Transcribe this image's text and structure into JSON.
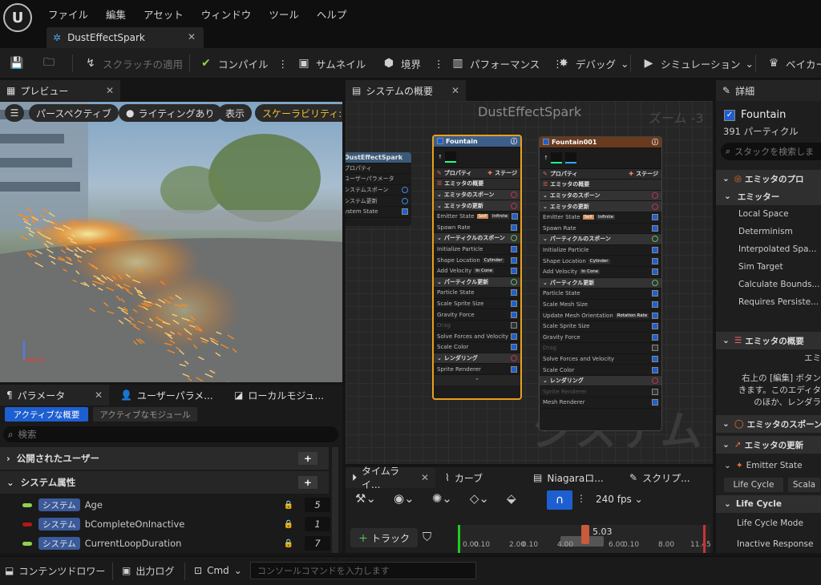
{
  "menu": [
    "ファイル",
    "編集",
    "アセット",
    "ウィンドウ",
    "ツール",
    "ヘルプ"
  ],
  "doc_tab": {
    "title": "DustEffectSpark"
  },
  "toolbar": {
    "apply_scratch": "スクラッチの適用",
    "compile": "コンパイル",
    "thumbnail": "サムネイル",
    "bounds": "境界",
    "performance": "パフォーマンス",
    "debug": "デバッグ",
    "simulation": "シミュレーション",
    "baker": "ベイカー"
  },
  "preview": {
    "tab": "プレビュー",
    "perspective": "パースペクティブ",
    "lighting": "ライティングあり",
    "show": "表示",
    "scalability": "スケーラビリティ:シ"
  },
  "graph": {
    "tab": "システムの概要",
    "title": "DustEffectSpark",
    "zoom": "ズーム -3",
    "watermark": "システム",
    "system_node": {
      "title": "DustEffectSpark",
      "rows": [
        "プロパティ",
        "ユーザーパラメータ",
        "システムスポーン",
        "システム更新",
        "ystem State"
      ]
    },
    "fountain": {
      "title": "Fountain",
      "props": "プロパティ",
      "stage": "ステージ",
      "summary": "エミッタの概要",
      "rows": [
        {
          "t": "エミッタのスポーン",
          "k": "sub"
        },
        {
          "t": "エミッタの更新",
          "k": "sub"
        },
        {
          "t": "Emitter State",
          "k": "row",
          "tag": "Self",
          "tag2": "Infinite"
        },
        {
          "t": "Spawn Rate",
          "k": "row"
        },
        {
          "t": "パーティクルのスポーン",
          "k": "sub"
        },
        {
          "t": "Initialize Particle",
          "k": "row"
        },
        {
          "t": "Shape Location",
          "k": "row",
          "tag": "Cylinder"
        },
        {
          "t": "Add Velocity",
          "k": "row",
          "tag": "In Cone"
        },
        {
          "t": "パーティクル更新",
          "k": "sub"
        },
        {
          "t": "Particle State",
          "k": "row"
        },
        {
          "t": "Scale Sprite Size",
          "k": "row"
        },
        {
          "t": "Gravity Force",
          "k": "row"
        },
        {
          "t": "Drag",
          "k": "off"
        },
        {
          "t": "Solve Forces and Velocity",
          "k": "row"
        },
        {
          "t": "Scale Color",
          "k": "row"
        },
        {
          "t": "レンダリング",
          "k": "sub"
        },
        {
          "t": "Sprite Renderer",
          "k": "row"
        }
      ]
    },
    "fountain001": {
      "title": "Fountain001",
      "props": "プロパティ",
      "stage": "ステージ",
      "summary": "エミッタの概要",
      "rows": [
        {
          "t": "エミッタのスポーン",
          "k": "sub"
        },
        {
          "t": "エミッタの更新",
          "k": "sub"
        },
        {
          "t": "Emitter State",
          "k": "row",
          "tag": "Self",
          "tag2": "Infinite"
        },
        {
          "t": "Spawn Rate",
          "k": "row"
        },
        {
          "t": "パーティクルのスポーン",
          "k": "sub"
        },
        {
          "t": "Initialize Particle",
          "k": "row"
        },
        {
          "t": "Shape Location",
          "k": "row",
          "tag": "Cylinder"
        },
        {
          "t": "Add Velocity",
          "k": "row",
          "tag": "In Cone"
        },
        {
          "t": "パーティクル更新",
          "k": "sub"
        },
        {
          "t": "Particle State",
          "k": "row"
        },
        {
          "t": "Scale Mesh Size",
          "k": "row"
        },
        {
          "t": "Update Mesh Orientation",
          "k": "row",
          "tag": "Rotation Rate"
        },
        {
          "t": "Scale Sprite Size",
          "k": "row"
        },
        {
          "t": "Gravity Force",
          "k": "row"
        },
        {
          "t": "Drag",
          "k": "off"
        },
        {
          "t": "Solve Forces and Velocity",
          "k": "row"
        },
        {
          "t": "Scale Color",
          "k": "row"
        },
        {
          "t": "レンダリング",
          "k": "sub"
        },
        {
          "t": "Sprite Renderer",
          "k": "off"
        },
        {
          "t": "Mesh Renderer",
          "k": "row"
        }
      ]
    }
  },
  "details": {
    "tab": "詳細",
    "emitter_name": "Fountain",
    "particles": "391 パーティクル",
    "search_placeholder": "スタックを検索しま",
    "rows": [
      {
        "t": "エミッタのプロ",
        "k": "sec"
      },
      {
        "t": "エミッター",
        "k": "sec2"
      },
      {
        "t": "Local Space",
        "k": "prop"
      },
      {
        "t": "Determinism",
        "k": "prop"
      },
      {
        "t": "Interpolated Spa...",
        "k": "prop"
      },
      {
        "t": "Sim Target",
        "k": "prop"
      },
      {
        "t": "Calculate Bounds...",
        "k": "prop"
      },
      {
        "t": "Requires Persiste...",
        "k": "prop"
      }
    ],
    "summary_sec": "エミッタの概要",
    "summary_text": [
      "エミ",
      "右上の [編集] ボタン",
      "きます。このエディタ",
      "のほか、レンダラ"
    ],
    "spawn_sec": "エミッタのスポーン",
    "update_sec": "エミッタの更新",
    "state_sec": "Emitter State",
    "life_cycle_btn": "Life Cycle",
    "scala_btn": "Scala",
    "life_cycle": "Life Cycle",
    "life_cycle_mode": "Life Cycle Mode",
    "inactive_response": "Inactive Response"
  },
  "timeline": {
    "tabs": [
      "タイムライ...",
      "カーブ",
      "Niagaraロ...",
      "スクリプ..."
    ],
    "fps": "240 fps",
    "add_track": "トラック",
    "current": "5.03",
    "ticks": [
      "0.00",
      "0.10",
      "2.00",
      "0.10",
      "4.00",
      "6.00",
      "0.10",
      "8.00",
      "11.45"
    ]
  },
  "params": {
    "tabs": [
      "パラメータ",
      "ユーザーパラメ...",
      "ローカルモジュ..."
    ],
    "active_overview": "アクティブな概要",
    "active_modules": "アクティブなモジュール",
    "search_placeholder": "検索",
    "public_user": "公開されたユーザー",
    "system_attrs": "システム属性",
    "rows": [
      {
        "badge": "システム",
        "name": "Age",
        "value": "5",
        "color": "#8fd14f"
      },
      {
        "badge": "システム",
        "name": "bCompleteOnInactive",
        "value": "1",
        "color": "#b01818"
      },
      {
        "badge": "システム",
        "name": "CurrentLoopDuration",
        "value": "7",
        "color": "#8fd14f"
      }
    ]
  },
  "statusbar": {
    "content_drawer": "コンテンツドロワー",
    "output_log": "出力ログ",
    "cmd": "Cmd",
    "console_placeholder": "コンソールコマンドを入力します"
  }
}
